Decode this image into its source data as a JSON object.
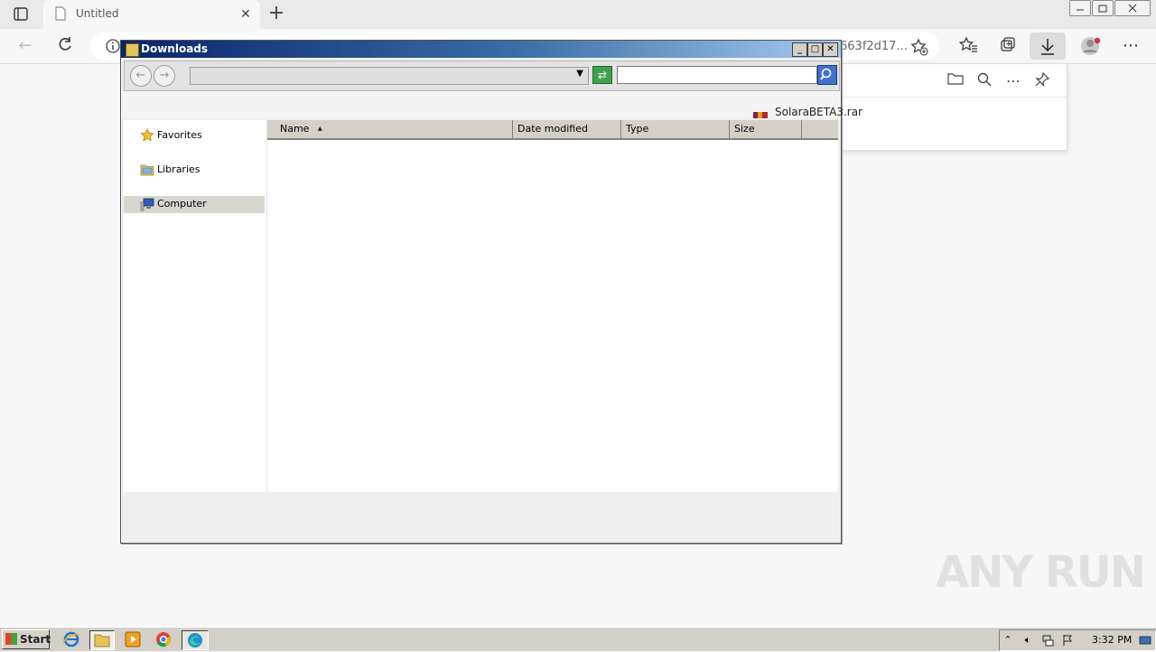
{
  "browser": {
    "tab": {
      "title": "Untitled"
    },
    "new_tab_label": "+",
    "address": {
      "url_tail": "663f2d17..."
    },
    "icons": {
      "tab_list": "tab-list-icon",
      "back": "back-arrow-icon",
      "refresh": "refresh-icon",
      "info": "info-icon",
      "add_favorite": "add-favorite-icon",
      "favorites": "favorites-icon",
      "collections": "collections-icon",
      "downloads": "download-icon",
      "profile": "profile-icon",
      "menu": "more-icon"
    },
    "downloads_panel": {
      "items": [
        {
          "name": "SolaraBETA3.rar"
        }
      ]
    }
  },
  "explorer": {
    "title": "Downloads",
    "nav_pane": [
      {
        "label": "Favorites",
        "icon": "star-icon"
      },
      {
        "label": "Libraries",
        "icon": "libraries-icon"
      },
      {
        "label": "Computer",
        "icon": "computer-icon",
        "selected": true
      }
    ],
    "columns": [
      "Name",
      "Date modified",
      "Type",
      "Size"
    ],
    "sort_indicator": "▲",
    "sorted_by": "Name"
  },
  "watermark": "ANY RUN",
  "taskbar": {
    "start_label": "Start",
    "clock": "3:32 PM",
    "pinned": [
      "ie-icon",
      "explorer-icon",
      "media-player-icon",
      "chrome-icon",
      "edge-icon"
    ]
  },
  "colors": {
    "titlebar_start": "#0a246a",
    "titlebar_end": "#a6caf0",
    "taskbar": "#d4d0c8",
    "browser_bg": "#f7f7f7"
  }
}
